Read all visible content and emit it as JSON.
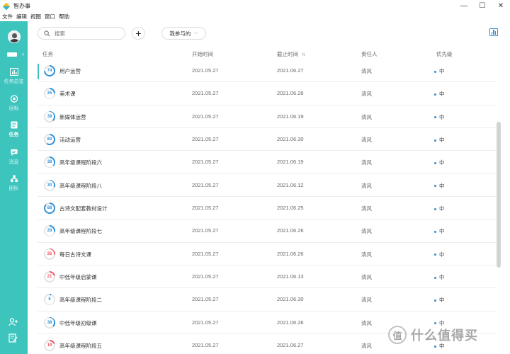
{
  "app": {
    "title": "智办事"
  },
  "window_controls": [
    "—",
    "☐",
    "✕"
  ],
  "menu": [
    "文件",
    "编辑",
    "视图",
    "窗口",
    "帮助"
  ],
  "rail": {
    "items": [
      {
        "label": "任务总览",
        "icon": "chart-icon"
      },
      {
        "label": "目标",
        "icon": "target-icon"
      },
      {
        "label": "任务",
        "icon": "task-list-icon"
      },
      {
        "label": "消息",
        "icon": "message-icon"
      },
      {
        "label": "团队",
        "icon": "team-icon"
      }
    ]
  },
  "toolbar": {
    "search_placeholder": "搜索",
    "add_label": "+",
    "filter_label": "我参与的"
  },
  "columns": {
    "task": "任务",
    "start": "开始时间",
    "deadline": "截止时间",
    "owner": "责任人",
    "priority": "优先级"
  },
  "colors": {
    "accent": "#3cc4bd",
    "progress_blue": "#2d8fd6",
    "progress_red": "#f0525e",
    "ring_track": "#e2e2e2"
  },
  "rows": [
    {
      "progress": "74",
      "name": "用户运营",
      "start": "2021.05.27",
      "end": "2021.06.27",
      "owner": "清风",
      "priority": "中",
      "status": "blue"
    },
    {
      "progress": "25",
      "name": "美术课",
      "start": "2021.05.27",
      "end": "2021.06.26",
      "owner": "清风",
      "priority": "中",
      "status": "blue"
    },
    {
      "progress": "39",
      "name": "新媒体运营",
      "start": "2021.05.27",
      "end": "2021.06.19",
      "owner": "清风",
      "priority": "中",
      "status": "blue"
    },
    {
      "progress": "60",
      "name": "活动运营",
      "start": "2021.05.27",
      "end": "2021.06.30",
      "owner": "清风",
      "priority": "中",
      "status": "blue"
    },
    {
      "progress": "38",
      "name": "高年级课程阶段六",
      "start": "2021.05.27",
      "end": "2021.06.19",
      "owner": "清风",
      "priority": "中",
      "status": "blue"
    },
    {
      "progress": "30",
      "name": "高年级课程阶段八",
      "start": "2021.05.27",
      "end": "2021.06.12",
      "owner": "清风",
      "priority": "中",
      "status": "blue"
    },
    {
      "progress": "88",
      "name": "古诗文配套教材设计",
      "start": "2021.05.27",
      "end": "2021.06.25",
      "owner": "清风",
      "priority": "中",
      "status": "blue"
    },
    {
      "progress": "28",
      "name": "高年级课程阶段七",
      "start": "2021.05.27",
      "end": "2021.06.26",
      "owner": "清风",
      "priority": "中",
      "status": "blue"
    },
    {
      "progress": "26",
      "name": "每日古诗文课",
      "start": "2021.05.27",
      "end": "2021.06.26",
      "owner": "清风",
      "priority": "中",
      "status": "red"
    },
    {
      "progress": "21",
      "name": "中低年级启蒙课",
      "start": "2021.05.27",
      "end": "2021.06.13",
      "owner": "清风",
      "priority": "中",
      "status": "red"
    },
    {
      "progress": "5",
      "name": "高年级课程阶段二",
      "start": "2021.05.27",
      "end": "2021.06.30",
      "owner": "清风",
      "priority": "中",
      "status": "blue"
    },
    {
      "progress": "38",
      "name": "中低年级初级课",
      "start": "2021.05.27",
      "end": "2021.06.26",
      "owner": "清风",
      "priority": "中",
      "status": "blue"
    },
    {
      "progress": "19",
      "name": "高年级课程阶段五",
      "start": "2021.05.27",
      "end": "2021.06.27",
      "owner": "清风",
      "priority": "中",
      "status": "red"
    }
  ],
  "watermark": {
    "seal": "值",
    "text": "什么值得买"
  }
}
